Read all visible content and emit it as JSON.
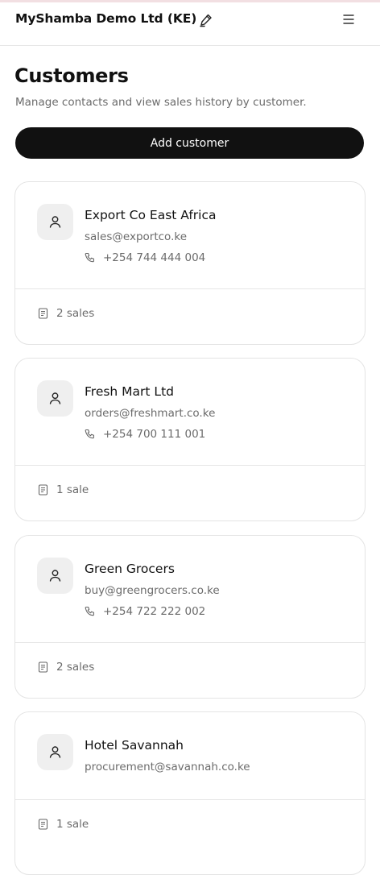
{
  "header": {
    "org_name": "MyShamba Demo Ltd (KE)",
    "edit_icon": "pencil-icon",
    "menu_icon": "hamburger-menu-icon"
  },
  "page": {
    "title": "Customers",
    "subtitle": "Manage contacts and view sales history by customer.",
    "add_button_label": "Add customer"
  },
  "customers": [
    {
      "name": "Export Co East Africa",
      "email": "sales@exportco.ke",
      "phone": "+254 744 444 004",
      "sales": "2 sales"
    },
    {
      "name": "Fresh Mart Ltd",
      "email": "orders@freshmart.co.ke",
      "phone": "+254 700 111 001",
      "sales": "1 sale"
    },
    {
      "name": "Green Grocers",
      "email": "buy@greengrocers.co.ke",
      "phone": "+254 722 222 002",
      "sales": "2 sales"
    },
    {
      "name": "Hotel Savannah",
      "email": "procurement@savannah.co.ke",
      "phone": "",
      "sales": "1 sale"
    }
  ],
  "colors": {
    "primary_button": "#111111",
    "muted_text": "#6b6b6b",
    "border": "#e4e4e4",
    "avatar_bg": "#efefef"
  }
}
